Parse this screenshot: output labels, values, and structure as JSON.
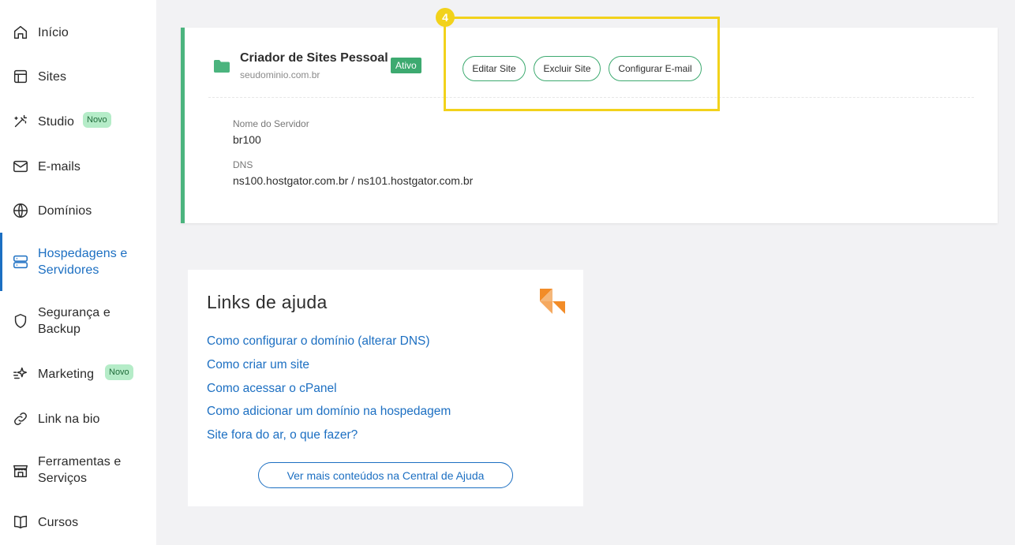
{
  "sidebar": {
    "items": [
      {
        "label": "Início",
        "icon": "home-icon"
      },
      {
        "label": "Sites",
        "icon": "layout-icon"
      },
      {
        "label": "Studio",
        "icon": "magic-wand-icon",
        "badge": "Novo"
      },
      {
        "label": "E-mails",
        "icon": "mail-icon"
      },
      {
        "label": "Domínios",
        "icon": "globe-icon"
      },
      {
        "label": "Hospedagens e Servidores",
        "icon": "server-icon",
        "active": true
      },
      {
        "label": "Segurança e Backup",
        "icon": "shield-icon"
      },
      {
        "label": "Marketing",
        "icon": "sparkle-icon",
        "badge": "Novo"
      },
      {
        "label": "Link na bio",
        "icon": "link-icon"
      },
      {
        "label": "Ferramentas e Serviços",
        "icon": "store-icon"
      },
      {
        "label": "Cursos",
        "icon": "book-icon"
      }
    ]
  },
  "site_card": {
    "title": "Criador de Sites Pessoal",
    "domain": "seudominio.com.br",
    "status": "Ativo",
    "buttons": {
      "edit": "Editar Site",
      "delete": "Excluir Site",
      "email": "Configurar E-mail"
    },
    "server_label": "Nome do Servidor",
    "server_value": "br100",
    "dns_label": "DNS",
    "dns_value": "ns100.hostgator.com.br / ns101.hostgator.com.br"
  },
  "highlight": {
    "step": "4"
  },
  "help": {
    "title": "Links de ajuda",
    "links": [
      "Como configurar o domínio (alterar DNS)",
      "Como criar um site",
      "Como acessar o cPanel",
      "Como adicionar um domínio na hospedagem",
      "Site fora do ar, o que fazer?"
    ],
    "more_button": "Ver mais conteúdos na Central de Ajuda"
  },
  "colors": {
    "accent_blue": "#1c6fc2",
    "accent_green": "#3daa70",
    "highlight_yellow": "#f2d21b",
    "logo_orange": "#f28c28"
  }
}
